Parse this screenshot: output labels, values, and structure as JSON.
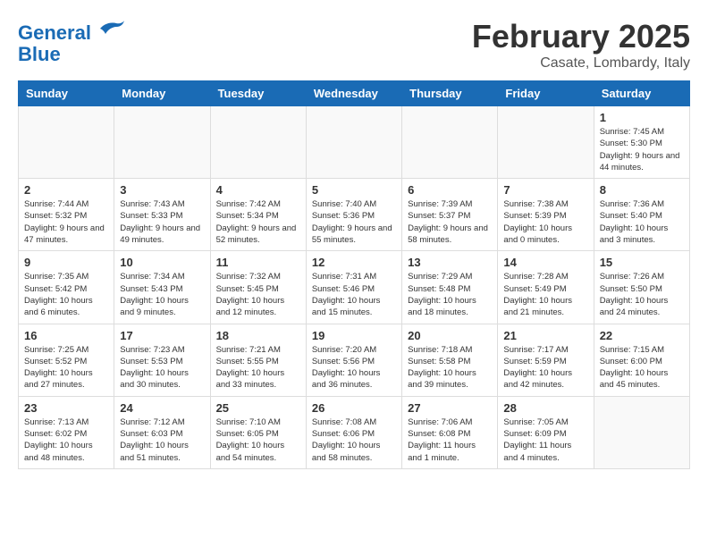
{
  "header": {
    "logo_line1": "General",
    "logo_line2": "Blue",
    "month_title": "February 2025",
    "location": "Casate, Lombardy, Italy"
  },
  "weekdays": [
    "Sunday",
    "Monday",
    "Tuesday",
    "Wednesday",
    "Thursday",
    "Friday",
    "Saturday"
  ],
  "weeks": [
    [
      {
        "day": "",
        "info": ""
      },
      {
        "day": "",
        "info": ""
      },
      {
        "day": "",
        "info": ""
      },
      {
        "day": "",
        "info": ""
      },
      {
        "day": "",
        "info": ""
      },
      {
        "day": "",
        "info": ""
      },
      {
        "day": "1",
        "info": "Sunrise: 7:45 AM\nSunset: 5:30 PM\nDaylight: 9 hours and 44 minutes."
      }
    ],
    [
      {
        "day": "2",
        "info": "Sunrise: 7:44 AM\nSunset: 5:32 PM\nDaylight: 9 hours and 47 minutes."
      },
      {
        "day": "3",
        "info": "Sunrise: 7:43 AM\nSunset: 5:33 PM\nDaylight: 9 hours and 49 minutes."
      },
      {
        "day": "4",
        "info": "Sunrise: 7:42 AM\nSunset: 5:34 PM\nDaylight: 9 hours and 52 minutes."
      },
      {
        "day": "5",
        "info": "Sunrise: 7:40 AM\nSunset: 5:36 PM\nDaylight: 9 hours and 55 minutes."
      },
      {
        "day": "6",
        "info": "Sunrise: 7:39 AM\nSunset: 5:37 PM\nDaylight: 9 hours and 58 minutes."
      },
      {
        "day": "7",
        "info": "Sunrise: 7:38 AM\nSunset: 5:39 PM\nDaylight: 10 hours and 0 minutes."
      },
      {
        "day": "8",
        "info": "Sunrise: 7:36 AM\nSunset: 5:40 PM\nDaylight: 10 hours and 3 minutes."
      }
    ],
    [
      {
        "day": "9",
        "info": "Sunrise: 7:35 AM\nSunset: 5:42 PM\nDaylight: 10 hours and 6 minutes."
      },
      {
        "day": "10",
        "info": "Sunrise: 7:34 AM\nSunset: 5:43 PM\nDaylight: 10 hours and 9 minutes."
      },
      {
        "day": "11",
        "info": "Sunrise: 7:32 AM\nSunset: 5:45 PM\nDaylight: 10 hours and 12 minutes."
      },
      {
        "day": "12",
        "info": "Sunrise: 7:31 AM\nSunset: 5:46 PM\nDaylight: 10 hours and 15 minutes."
      },
      {
        "day": "13",
        "info": "Sunrise: 7:29 AM\nSunset: 5:48 PM\nDaylight: 10 hours and 18 minutes."
      },
      {
        "day": "14",
        "info": "Sunrise: 7:28 AM\nSunset: 5:49 PM\nDaylight: 10 hours and 21 minutes."
      },
      {
        "day": "15",
        "info": "Sunrise: 7:26 AM\nSunset: 5:50 PM\nDaylight: 10 hours and 24 minutes."
      }
    ],
    [
      {
        "day": "16",
        "info": "Sunrise: 7:25 AM\nSunset: 5:52 PM\nDaylight: 10 hours and 27 minutes."
      },
      {
        "day": "17",
        "info": "Sunrise: 7:23 AM\nSunset: 5:53 PM\nDaylight: 10 hours and 30 minutes."
      },
      {
        "day": "18",
        "info": "Sunrise: 7:21 AM\nSunset: 5:55 PM\nDaylight: 10 hours and 33 minutes."
      },
      {
        "day": "19",
        "info": "Sunrise: 7:20 AM\nSunset: 5:56 PM\nDaylight: 10 hours and 36 minutes."
      },
      {
        "day": "20",
        "info": "Sunrise: 7:18 AM\nSunset: 5:58 PM\nDaylight: 10 hours and 39 minutes."
      },
      {
        "day": "21",
        "info": "Sunrise: 7:17 AM\nSunset: 5:59 PM\nDaylight: 10 hours and 42 minutes."
      },
      {
        "day": "22",
        "info": "Sunrise: 7:15 AM\nSunset: 6:00 PM\nDaylight: 10 hours and 45 minutes."
      }
    ],
    [
      {
        "day": "23",
        "info": "Sunrise: 7:13 AM\nSunset: 6:02 PM\nDaylight: 10 hours and 48 minutes."
      },
      {
        "day": "24",
        "info": "Sunrise: 7:12 AM\nSunset: 6:03 PM\nDaylight: 10 hours and 51 minutes."
      },
      {
        "day": "25",
        "info": "Sunrise: 7:10 AM\nSunset: 6:05 PM\nDaylight: 10 hours and 54 minutes."
      },
      {
        "day": "26",
        "info": "Sunrise: 7:08 AM\nSunset: 6:06 PM\nDaylight: 10 hours and 58 minutes."
      },
      {
        "day": "27",
        "info": "Sunrise: 7:06 AM\nSunset: 6:08 PM\nDaylight: 11 hours and 1 minute."
      },
      {
        "day": "28",
        "info": "Sunrise: 7:05 AM\nSunset: 6:09 PM\nDaylight: 11 hours and 4 minutes."
      },
      {
        "day": "",
        "info": ""
      }
    ]
  ]
}
